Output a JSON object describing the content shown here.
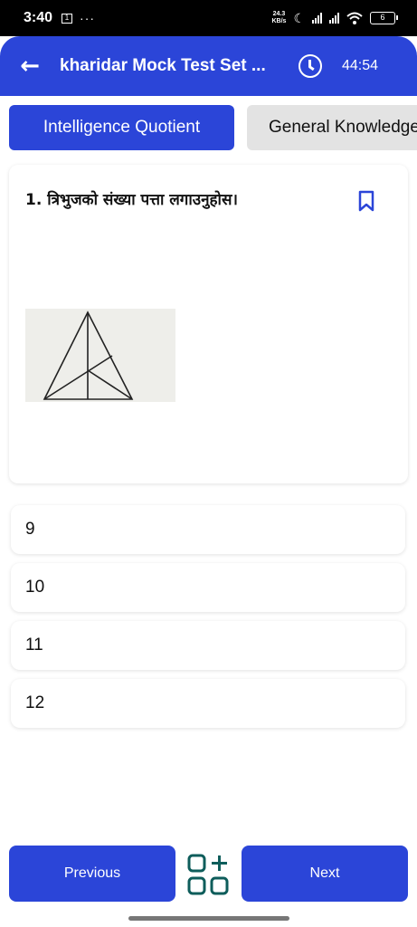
{
  "status_bar": {
    "time": "3:40",
    "notification_badge": "1",
    "more": "···",
    "speed_value": "24.3",
    "speed_unit": "KB/s",
    "battery": "6"
  },
  "app_bar": {
    "title": "kharidar Mock Test Set ...",
    "timer": "44:54"
  },
  "tabs": [
    {
      "label": "Intelligence Quotient",
      "active": true
    },
    {
      "label": "General Knowledge",
      "active": false
    }
  ],
  "question": {
    "text": "1. त्रिभुजको संख्या पत्ता लगाउनुहोस।"
  },
  "options": [
    {
      "label": "9"
    },
    {
      "label": "10"
    },
    {
      "label": "11"
    },
    {
      "label": "12"
    }
  ],
  "footer": {
    "previous_label": "Previous",
    "next_label": "Next"
  },
  "colors": {
    "accent": "#2b45d8",
    "teal_icon": "#0e5d5b"
  }
}
